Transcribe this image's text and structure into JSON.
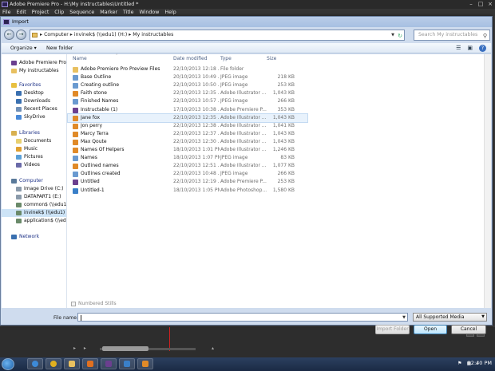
{
  "premiere": {
    "title": "Adobe Premiere Pro - H:\\My instructables\\Untitled *",
    "menu": [
      "File",
      "Edit",
      "Project",
      "Clip",
      "Sequence",
      "Marker",
      "Title",
      "Window",
      "Help"
    ]
  },
  "dialog": {
    "title": "Import",
    "breadcrumb": [
      "Computer",
      "invinek$ (\\\\edu1) (H:)",
      "My instructables"
    ],
    "search_placeholder": "Search My instructables",
    "toolbar": {
      "organize": "Organize ▾",
      "new_folder": "New folder"
    },
    "nav": {
      "top": [
        {
          "label": "Adobe Premiere Pro C",
          "icon": "premiere-icon"
        },
        {
          "label": "My instructables",
          "icon": "folder-icon"
        }
      ],
      "favorites": {
        "label": "Favorites",
        "items": [
          {
            "label": "Desktop",
            "icon": "desktop-icon"
          },
          {
            "label": "Downloads",
            "icon": "downloads-icon"
          },
          {
            "label": "Recent Places",
            "icon": "recent-places-icon"
          },
          {
            "label": "SkyDrive",
            "icon": "skydrive-icon"
          }
        ]
      },
      "libraries": {
        "label": "Libraries",
        "items": [
          {
            "label": "Documents",
            "icon": "documents-icon"
          },
          {
            "label": "Music",
            "icon": "music-icon"
          },
          {
            "label": "Pictures",
            "icon": "pictures-icon"
          },
          {
            "label": "Videos",
            "icon": "videos-icon"
          }
        ]
      },
      "computer": {
        "label": "Computer",
        "items": [
          {
            "label": "Image Drive (C:)",
            "icon": "drive-icon"
          },
          {
            "label": "DATAPART1 (E:)",
            "icon": "drive-icon"
          },
          {
            "label": "common$ (\\\\edu1)",
            "icon": "network-drive-icon"
          },
          {
            "label": "invinek$ (\\\\edu1) (H:)",
            "icon": "network-drive-icon"
          },
          {
            "label": "application$ (\\\\edu",
            "icon": "network-drive-icon"
          }
        ]
      },
      "network": {
        "label": "Network",
        "icon": "network-icon"
      }
    },
    "columns": {
      "name": "Name",
      "date": "Date modified",
      "type": "Type",
      "size": "Size"
    },
    "files": [
      {
        "name": "Adobe Premiere Pro Preview Files",
        "date": "22/10/2013 12:18 ...",
        "type": "File folder",
        "size": "",
        "icon": "folder",
        "color": "#e8c060"
      },
      {
        "name": "Base Outline",
        "date": "20/10/2013 10:49 ...",
        "type": "JPEG image",
        "size": "218 KB",
        "icon": "jpeg",
        "color": "#6a9ad0"
      },
      {
        "name": "Creating outline",
        "date": "22/10/2013 10:50 ...",
        "type": "JPEG image",
        "size": "253 KB",
        "icon": "jpeg",
        "color": "#6a9ad0"
      },
      {
        "name": "Faith stone",
        "date": "22/10/2013 12:35 ...",
        "type": "Adobe Illustrator ...",
        "size": "1,043 KB",
        "icon": "ai",
        "color": "#e08a28"
      },
      {
        "name": "Finished Names",
        "date": "22/10/2013 10:57 ...",
        "type": "JPEG image",
        "size": "266 KB",
        "icon": "jpeg",
        "color": "#6a9ad0"
      },
      {
        "name": "Instructable (1)",
        "date": "17/10/2013 10:38 ...",
        "type": "Adobe Premiere P...",
        "size": "353 KB",
        "icon": "prproj",
        "color": "#6b3f8f"
      },
      {
        "name": "Jane fox",
        "date": "22/10/2013 12:35 ...",
        "type": "Adobe Illustrator ...",
        "size": "1,043 KB",
        "icon": "ai",
        "color": "#e08a28"
      },
      {
        "name": "Jon perry",
        "date": "22/10/2013 12:38 ...",
        "type": "Adobe Illustrator ...",
        "size": "1,041 KB",
        "icon": "ai",
        "color": "#e08a28"
      },
      {
        "name": "Marcy Terra",
        "date": "22/10/2013 12:37 ...",
        "type": "Adobe Illustrator ...",
        "size": "1,043 KB",
        "icon": "ai",
        "color": "#e08a28"
      },
      {
        "name": "Max Qoute",
        "date": "22/10/2013 12:30 ...",
        "type": "Adobe Illustrator ...",
        "size": "1,043 KB",
        "icon": "ai",
        "color": "#e08a28"
      },
      {
        "name": "Names Of Helpers",
        "date": "18/10/2013 1:01 PM",
        "type": "Adobe Illustrator ...",
        "size": "1,246 KB",
        "icon": "ai",
        "color": "#e08a28"
      },
      {
        "name": "Names",
        "date": "18/10/2013 1:07 PM",
        "type": "JPEG image",
        "size": "83 KB",
        "icon": "jpeg",
        "color": "#6a9ad0"
      },
      {
        "name": "Outlined names",
        "date": "22/10/2013 12:51 ...",
        "type": "Adobe Illustrator ...",
        "size": "1,077 KB",
        "icon": "ai",
        "color": "#e08a28"
      },
      {
        "name": "Outlines created",
        "date": "22/10/2013 10:48 ...",
        "type": "JPEG image",
        "size": "266 KB",
        "icon": "jpeg",
        "color": "#6a9ad0"
      },
      {
        "name": "Untitled",
        "date": "22/10/2013 12:19 ...",
        "type": "Adobe Premiere P...",
        "size": "253 KB",
        "icon": "prproj",
        "color": "#6b3f8f"
      },
      {
        "name": "Untitled-1",
        "date": "18/10/2013 1:05 PM",
        "type": "Adobe Photoshop...",
        "size": "1,580 KB",
        "icon": "psd",
        "color": "#3a7fc8"
      }
    ],
    "selected_row": 6,
    "numbered_stills": "Numbered Stills",
    "file_name_label": "File name:",
    "file_name_value": "",
    "file_type_filter": "All Supported Media",
    "buttons": {
      "import_folder": "Import Folder",
      "open": "Open",
      "cancel": "Cancel"
    }
  },
  "taskbar": {
    "time": "12:40 PM"
  }
}
